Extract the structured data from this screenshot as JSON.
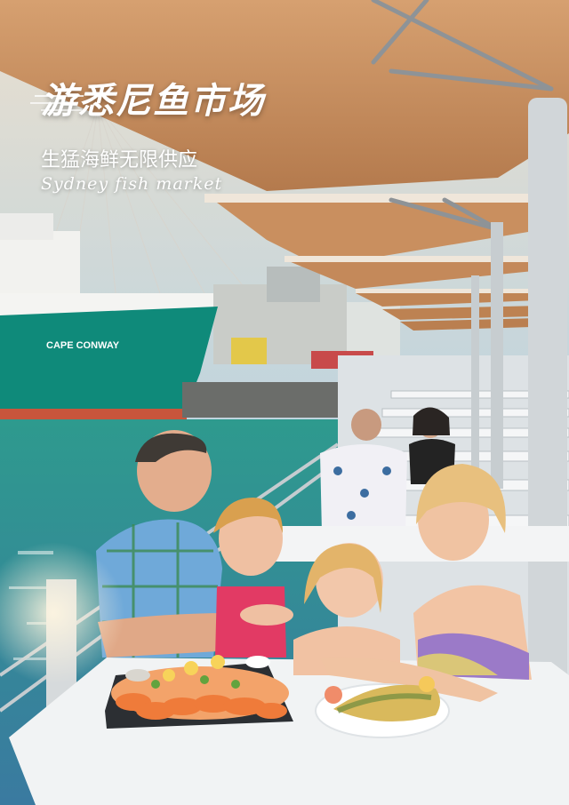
{
  "headline": {
    "title": "游悉尼鱼市场",
    "subtitle": "生猛海鲜无限供应",
    "subtitle_en": "Sydney fish market"
  },
  "photo": {
    "ship_name": "CAPE CONWAY"
  },
  "colors": {
    "umbrella": "#c98f5f",
    "ship_hull": "#0f8a7a",
    "water": "#2b8f86",
    "table": "#f1f3f4"
  }
}
